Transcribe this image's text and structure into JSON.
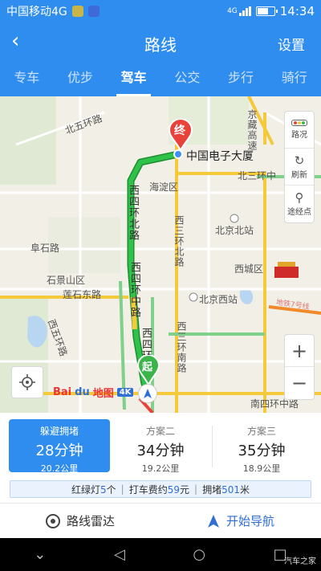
{
  "statusbar": {
    "carrier": "中国移动4G",
    "network": "4G",
    "time": "14:34"
  },
  "header": {
    "back_icon": "‹",
    "title": "路线",
    "settings": "设置"
  },
  "tabs": [
    {
      "label": "专车"
    },
    {
      "label": "优步"
    },
    {
      "label": "驾车",
      "active": true
    },
    {
      "label": "公交"
    },
    {
      "label": "步行"
    },
    {
      "label": "骑行"
    }
  ],
  "map": {
    "destination_name": "中国电子大厦",
    "end_marker": "终",
    "start_marker": "起",
    "labels": {
      "road_n1": "北五环路",
      "road_n2": "京藏高速",
      "haidian": "海淀区",
      "west4_north": "西四环北路",
      "west3_north": "西三环北路",
      "north3_middle": "北三环中",
      "beijing_north_station": "北京北站",
      "fushi_road": "阜石路",
      "xicheng": "西城区",
      "shijingshan": "石景山区",
      "lianshidong": "莲石东路",
      "west4_middle": "西四环中路",
      "beijing_west_station": "北京西站",
      "west3_south": "西三环南路",
      "west4_south": "西五环路",
      "south4_middle": "南四环中路",
      "west4_south_short": "西四环",
      "subway": "地铁7号线"
    },
    "controls": {
      "traffic": "路况",
      "refresh": "刷新",
      "waypoint": "途经点"
    },
    "zoom": {
      "in": "+",
      "out": "−"
    },
    "logo": {
      "bai": "Bai",
      "du": "du",
      "ditu": "地图",
      "quality": "4K"
    }
  },
  "plans": [
    {
      "name": "躲避拥堵",
      "duration": "28分钟",
      "distance": "20.2公里",
      "active": true
    },
    {
      "name": "方案二",
      "duration": "34分钟",
      "distance": "19.2公里"
    },
    {
      "name": "方案三",
      "duration": "35分钟",
      "distance": "18.9公里"
    }
  ],
  "stats": {
    "lights_label": "红绿灯",
    "lights_value": "5",
    "lights_unit": "个",
    "fare_label": "打车费约",
    "fare_value": "59",
    "fare_unit": "元",
    "jam_label": "拥堵",
    "jam_value": "501",
    "jam_unit": "米"
  },
  "actions": {
    "radar": "路线雷达",
    "navigate": "开始导航"
  },
  "watermark": "汽车之家",
  "colors": {
    "primary": "#2f8df0",
    "route_green": "#2ec24a",
    "route_yellow": "#f4c93a",
    "end_marker": "#e8423b"
  }
}
